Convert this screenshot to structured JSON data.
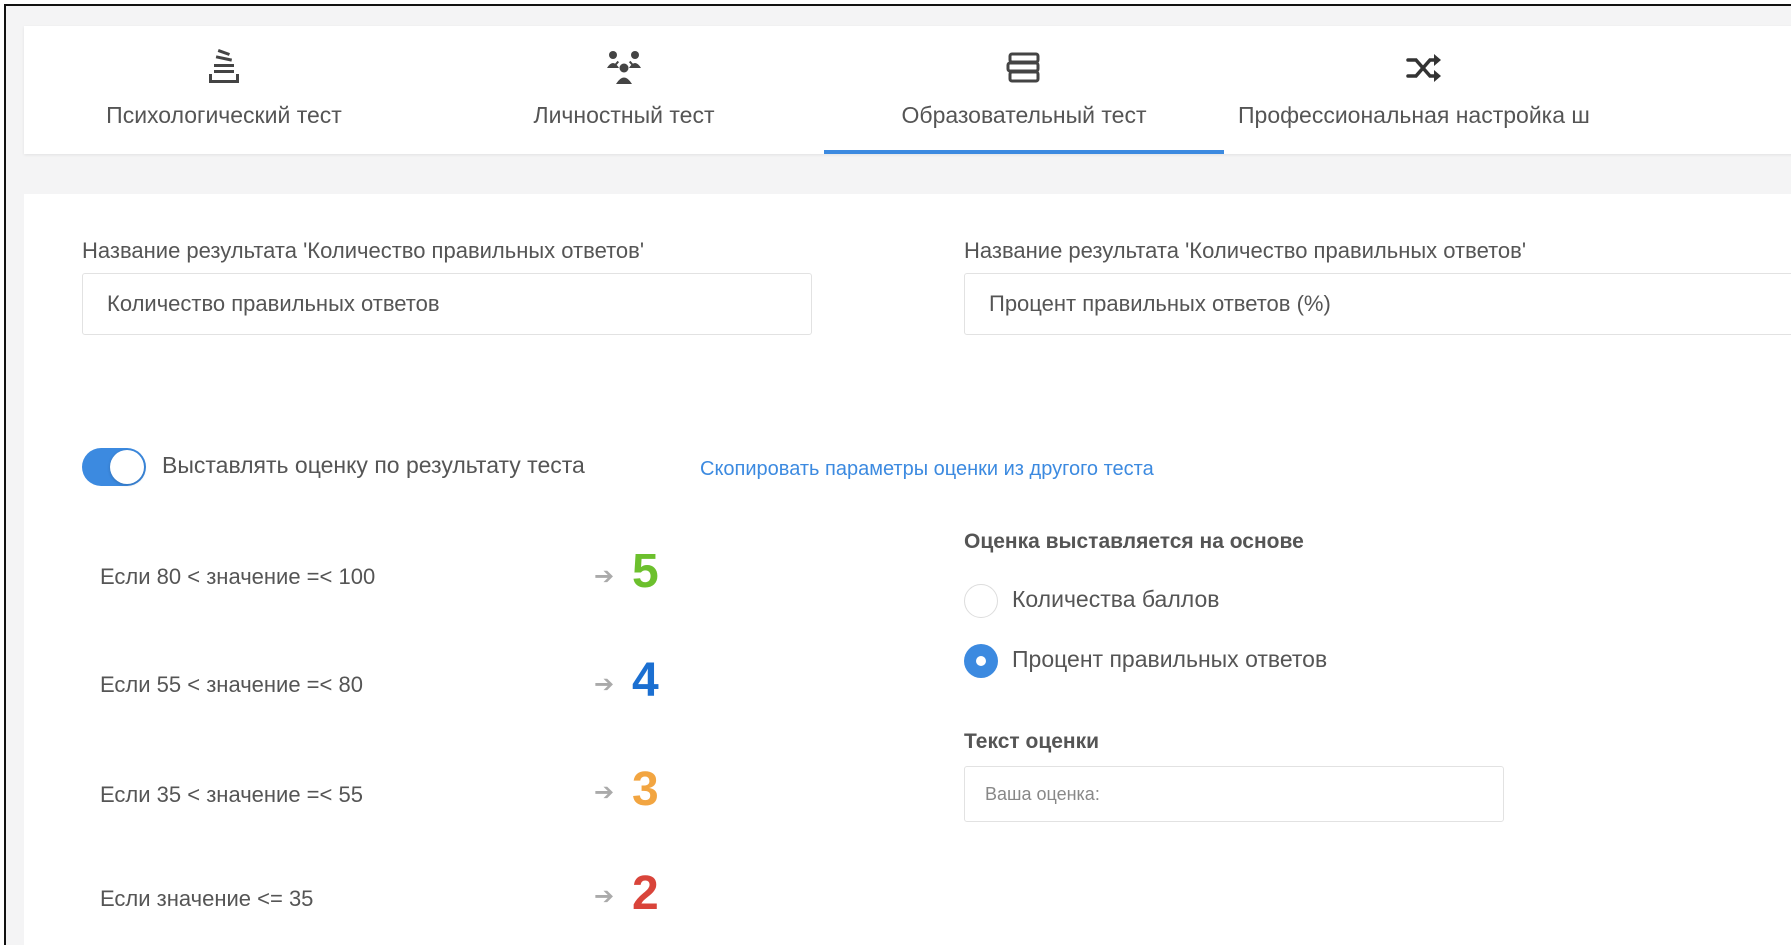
{
  "tabs": [
    {
      "label": "Психологический тест",
      "icon": "stack-icon",
      "active": false
    },
    {
      "label": "Личностный тест",
      "icon": "group-icon",
      "active": false
    },
    {
      "label": "Образовательный тест",
      "icon": "books-icon",
      "active": true
    },
    {
      "label": "Профессиональная настройка ш",
      "icon": "shuffle-icon",
      "active": false
    }
  ],
  "fields": {
    "left_label": "Название результата 'Количество правильных ответов'",
    "left_value": "Количество правильных ответов",
    "right_label": "Название результата 'Количество правильных ответов'",
    "right_value": "Процент правильных ответов (%)"
  },
  "toggle": {
    "label": "Выставлять оценку по результату теста",
    "on": true
  },
  "copy_link": "Скопировать параметры оценки из другого теста",
  "rules": [
    {
      "text": "Если 80 < значение =< 100",
      "arrow": "➔",
      "grade": "5",
      "color": "#6cc02d"
    },
    {
      "text": "Если 55 < значение =< 80",
      "arrow": "➔",
      "grade": "4",
      "color": "#1b6fd1"
    },
    {
      "text": "Если 35 < значение =< 55",
      "arrow": "➔",
      "grade": "3",
      "color": "#f2a541"
    },
    {
      "text": "Если значение <= 35",
      "arrow": "➔",
      "grade": "2",
      "color": "#d9443a"
    }
  ],
  "basis": {
    "title": "Оценка выставляется на основе",
    "options": [
      {
        "label": "Количества баллов",
        "selected": false
      },
      {
        "label": "Процент правильных ответов",
        "selected": true
      }
    ]
  },
  "grade_text": {
    "title": "Текст оценки",
    "value": "Ваша оценка:"
  },
  "colors": {
    "accent": "#3c8ae0"
  }
}
